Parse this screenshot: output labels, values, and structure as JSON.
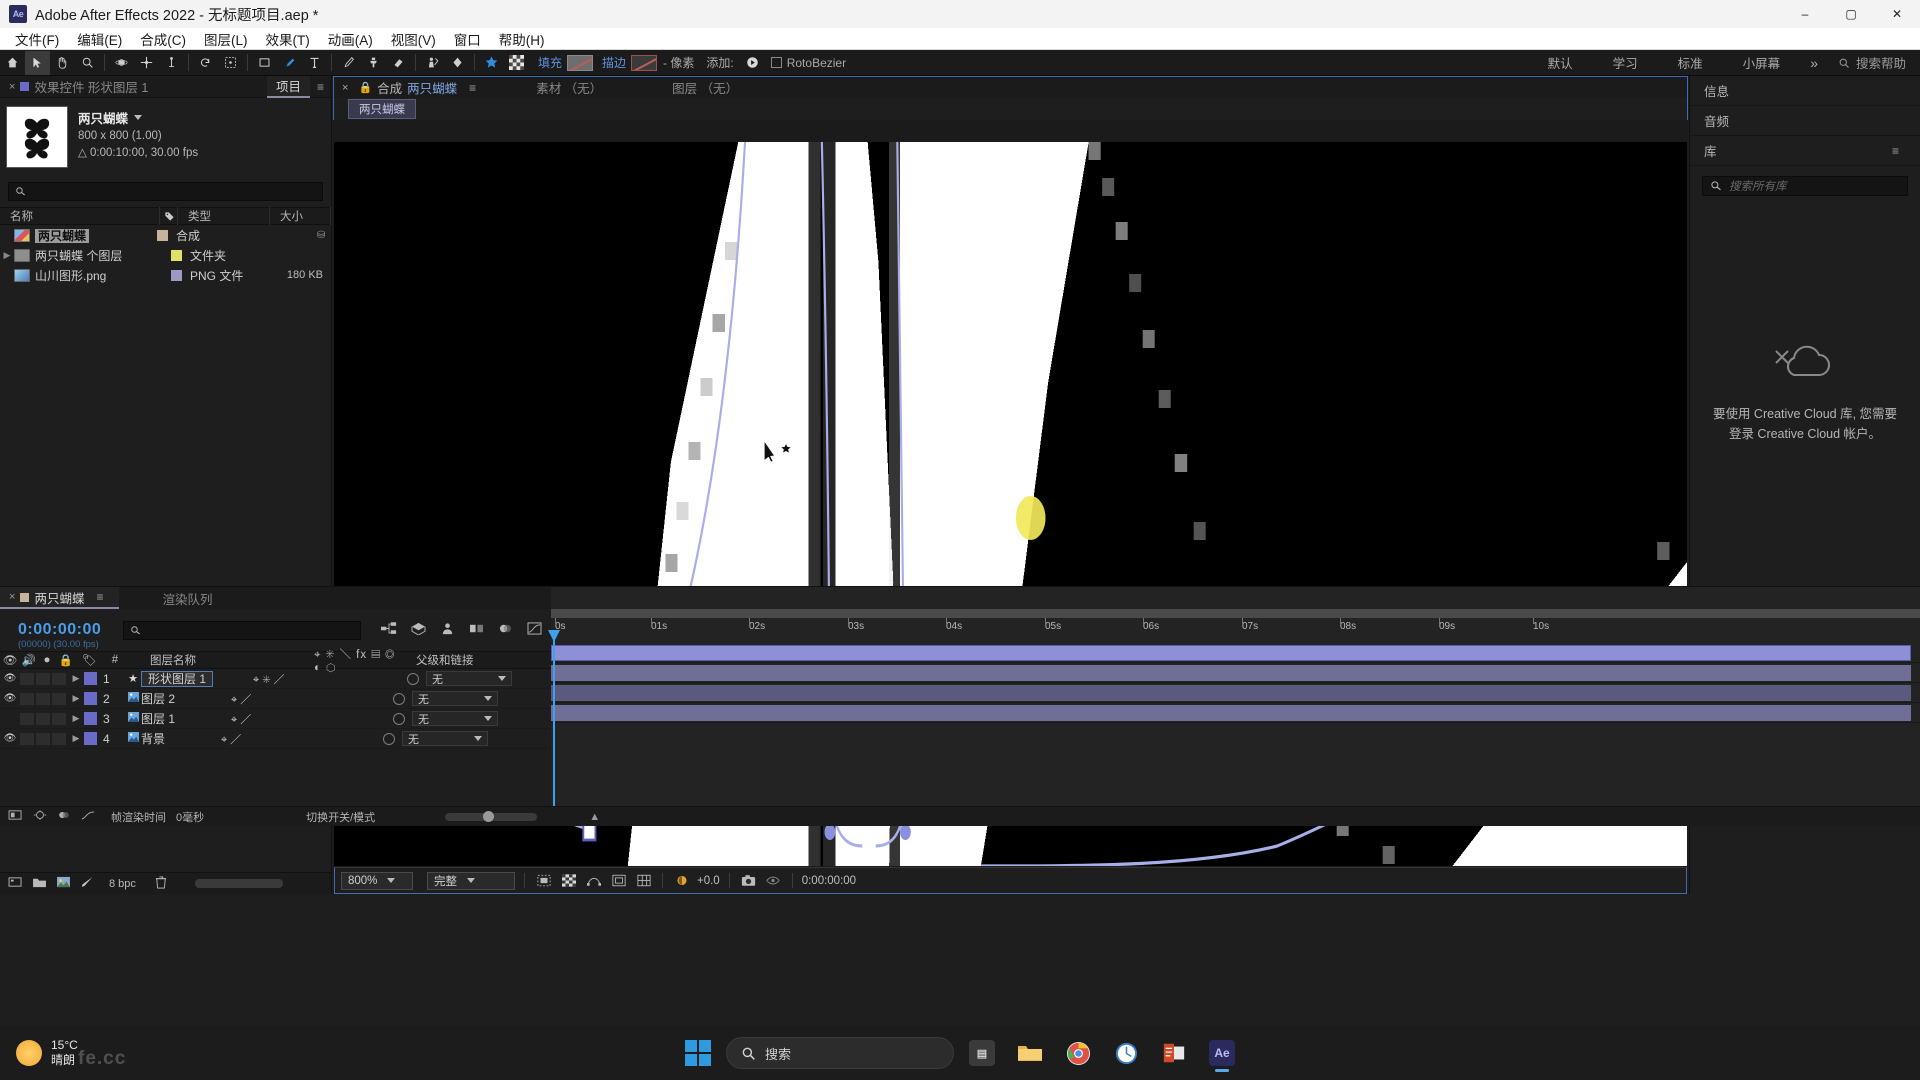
{
  "titlebar": {
    "app_icon": "ae-logo-icon",
    "title": "Adobe After Effects 2022 - 无标题项目.aep *",
    "minimize": "–",
    "maximize": "▢",
    "close": "✕"
  },
  "menubar": {
    "items": [
      {
        "label": "文件(F)",
        "name": "menu-file"
      },
      {
        "label": "编辑(E)",
        "name": "menu-edit"
      },
      {
        "label": "合成(C)",
        "name": "menu-composition"
      },
      {
        "label": "图层(L)",
        "name": "menu-layer"
      },
      {
        "label": "效果(T)",
        "name": "menu-effect"
      },
      {
        "label": "动画(A)",
        "name": "menu-animation"
      },
      {
        "label": "视图(V)",
        "name": "menu-view"
      },
      {
        "label": "窗口",
        "name": "menu-window"
      },
      {
        "label": "帮助(H)",
        "name": "menu-help"
      }
    ]
  },
  "toolbar": {
    "fill_label": "填充",
    "stroke_label": "描边",
    "stroke_unit": "- 像素",
    "add_label": "添加:",
    "rotobezier_label": "RotoBezier",
    "workspaces": [
      {
        "label": "默认",
        "name": "workspace-default"
      },
      {
        "label": "学习",
        "name": "workspace-learn"
      },
      {
        "label": "标准",
        "name": "workspace-standard"
      },
      {
        "label": "小屏幕",
        "name": "workspace-small-screen"
      }
    ],
    "more": "»",
    "help_placeholder": "搜索帮助"
  },
  "project": {
    "tabs": [
      {
        "label": "效果控件 形状图层 1",
        "name": "tab-effect-controls",
        "selected": false
      },
      {
        "label": "项目",
        "name": "tab-project",
        "selected": true
      }
    ],
    "comp_name": "两只蝴蝶",
    "comp_size": "800 x 800 (1.00)",
    "comp_duration": "△ 0:00:10:00, 30.00 fps",
    "search_placeholder": "",
    "columns": [
      {
        "label": "名称",
        "name": "column-name"
      },
      {
        "label": "类型",
        "name": "column-type"
      },
      {
        "label": "大小",
        "name": "column-size"
      }
    ],
    "items": [
      {
        "name": "两只蝴蝶",
        "type": "合成",
        "size": "",
        "icon": "composition-icon",
        "swatch": "#c7b39a",
        "selected": true,
        "has_twisty": false
      },
      {
        "name": "两只蝴蝶 个图层",
        "type": "文件夹",
        "size": "",
        "icon": "folder-icon",
        "swatch": "#e3e06a",
        "selected": false,
        "has_twisty": true
      },
      {
        "name": "山川图形.png",
        "type": "PNG 文件",
        "size": "180 KB",
        "icon": "png-icon",
        "swatch": "#9a9ac4",
        "selected": false,
        "has_twisty": false
      }
    ],
    "footer": {
      "bit_depth": "8 bpc"
    }
  },
  "composition": {
    "tab_close": "×",
    "tab_prefix": "合成",
    "tab_name": "两只蝴蝶",
    "other_tabs": [
      {
        "label": "素材 （无）",
        "name": "tab-footage"
      },
      {
        "label": "图层 （无）",
        "name": "tab-layer"
      }
    ],
    "chip_label": "两只蝴蝶",
    "zoom": "800%",
    "resolution": "完整",
    "exposure": "+0.0",
    "timecode": "0:00:00:00"
  },
  "right_panels": {
    "info": "信息",
    "audio": "音频",
    "library": "库",
    "library_search_placeholder": "搜索所有库",
    "cc_message": "要使用 Creative Cloud 库, 您需要登录 Creative Cloud 帐户。",
    "menu_icon": "hamburger-icon"
  },
  "timeline": {
    "tabs": [
      {
        "label": "两只蝴蝶",
        "name": "tab-comp-timeline",
        "selected": true
      },
      {
        "label": "渲染队列",
        "name": "tab-render-queue",
        "selected": false
      }
    ],
    "current_time": "0:00:00:00",
    "time_sub": "(00000) (30.00 fps)",
    "search_placeholder": "",
    "columns": {
      "num": "#",
      "layer_name": "图层名称",
      "parent": "父级和链接"
    },
    "layers": [
      {
        "index": "1",
        "name": "形状图层 1",
        "parent": "无",
        "color": "#6a6ac8",
        "visible": true,
        "selected": true,
        "star": "★",
        "bar_color": "#8f8fd8"
      },
      {
        "index": "2",
        "name": "图层 2",
        "parent": "无",
        "color": "#6a6ac8",
        "visible": true,
        "selected": false,
        "star": "",
        "bar_color": "#6e6e96"
      },
      {
        "index": "3",
        "name": "图层 1",
        "parent": "无",
        "color": "#6a6ac8",
        "visible": false,
        "selected": false,
        "star": "",
        "bar_color": "#5a5a7e"
      },
      {
        "index": "4",
        "name": "背景",
        "parent": "无",
        "color": "#6a6ac8",
        "visible": true,
        "selected": false,
        "star": "",
        "bar_color": "#6e6e96"
      }
    ],
    "ruler_ticks": [
      "0s",
      "01s",
      "02s",
      "03s",
      "04s",
      "05s",
      "06s",
      "07s",
      "08s",
      "09s",
      "10s"
    ],
    "footer": {
      "render_time_label": "帧渲染时间",
      "render_time_value": "0毫秒",
      "switch_label": "切换开关/模式"
    }
  },
  "taskbar": {
    "weather_temp": "15°C",
    "weather_desc": "晴朗",
    "search_placeholder": "搜索",
    "apps": [
      {
        "name": "taskview-icon",
        "glyph": "▤",
        "color": "#4a4a4a",
        "active": false
      },
      {
        "name": "file-explorer-icon",
        "glyph": "📁",
        "color": "#e3a83c",
        "active": false
      },
      {
        "name": "chrome-icon",
        "glyph": "◉",
        "color": "#e8e8e8",
        "active": false
      },
      {
        "name": "clock-icon",
        "glyph": "◷",
        "color": "#4a90d9",
        "active": false
      },
      {
        "name": "office-icon",
        "glyph": "▦",
        "color": "#d04a2a",
        "active": false
      },
      {
        "name": "after-effects-icon",
        "glyph": "Ae",
        "color": "#3a3a8a",
        "active": true
      }
    ],
    "watermark": "fe.cc"
  },
  "colors": {
    "accent_blue": "#3fa0ee",
    "link_blue": "#5f91dd",
    "panel_bg": "#1e1e1e",
    "toolbar_bg": "#1b1b1b",
    "layer_purple": "#6a6ac8"
  }
}
